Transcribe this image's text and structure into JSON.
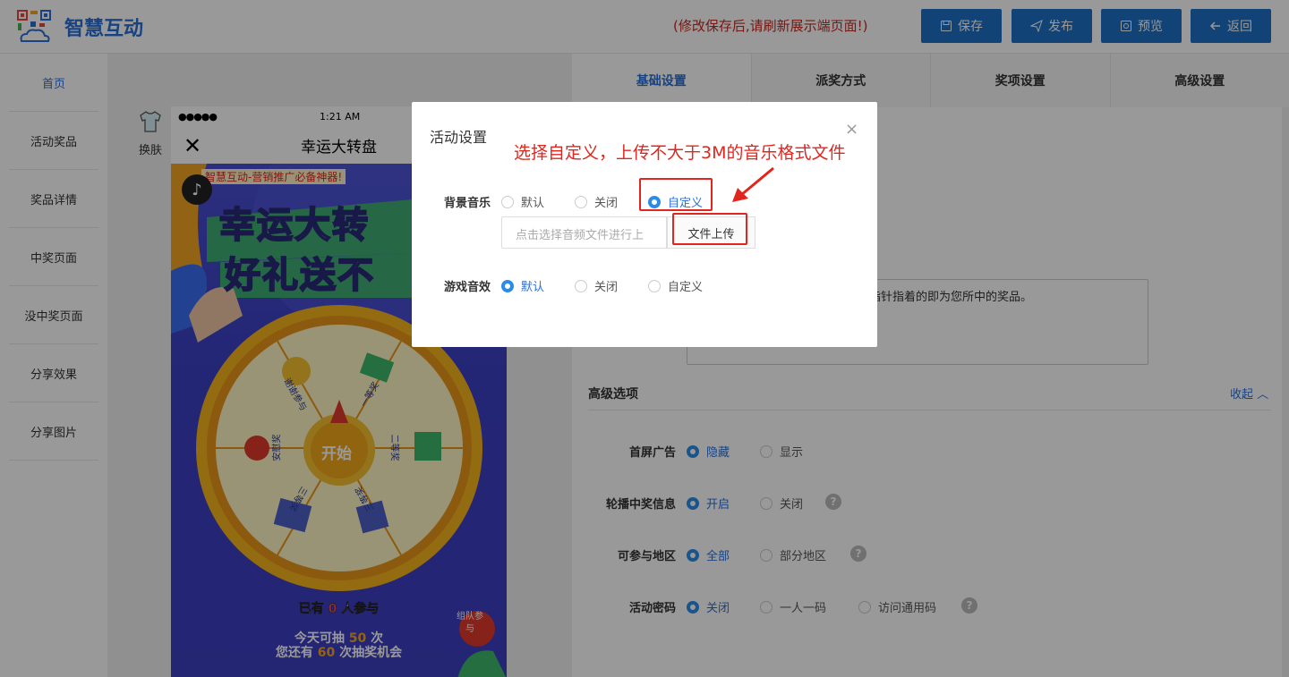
{
  "header": {
    "logo_text": "智慧互动",
    "notice": "(修改保存后,请刷新展示端页面!)",
    "buttons": {
      "save": "保存",
      "publish": "发布",
      "preview": "预览",
      "back": "返回"
    },
    "accent": "#1d70c7"
  },
  "sidebar": {
    "items": [
      {
        "label": "首页"
      },
      {
        "label": "活动奖品"
      },
      {
        "label": "奖品详情"
      },
      {
        "label": "中奖页面"
      },
      {
        "label": "没中奖页面"
      },
      {
        "label": "分享效果"
      },
      {
        "label": "分享图片"
      }
    ]
  },
  "preview": {
    "skin_label": "换肤",
    "status_time": "1:21 AM",
    "signal": "●●●●●",
    "nav_title": "幸运大转盘",
    "banner": "智慧互动-营销推广必备神器!",
    "headline_1": "幸运大转",
    "headline_2": "好礼送不",
    "wheel_center": "开始",
    "wheel_labels": [
      "谢谢参与",
      "一等奖",
      "二等奖",
      "三等奖",
      "三等奖",
      "安慰奖"
    ],
    "participants": {
      "prefix": "已有",
      "count": "0",
      "suffix": "人参与"
    },
    "today": {
      "prefix": "今天可抽",
      "count": "50",
      "suffix": "次"
    },
    "remaining": {
      "prefix": "您还有",
      "count": "60",
      "suffix": "次抽奖机会"
    },
    "team_badge": "组队参与"
  },
  "tabs": [
    {
      "label": "基础设置"
    },
    {
      "label": "派奖方式"
    },
    {
      "label": "奖项设置"
    },
    {
      "label": "高级设置"
    }
  ],
  "settings": {
    "description_text": "终指针指着的即为您所中的奖品。",
    "advanced_title": "高级选项",
    "collapse_label": "收起",
    "rows": [
      {
        "label": "首屏广告",
        "options": [
          "隐藏",
          "显示"
        ],
        "selected": 0
      },
      {
        "label": "轮播中奖信息",
        "options": [
          "开启",
          "关闭"
        ],
        "selected": 0
      },
      {
        "label": "可参与地区",
        "options": [
          "全部",
          "部分地区"
        ],
        "selected": 0
      },
      {
        "label": "活动密码",
        "options": [
          "关闭",
          "一人一码",
          "访问通用码"
        ],
        "selected": 0
      }
    ]
  },
  "modal": {
    "title": "活动设置",
    "close": "×",
    "annotation": "选择自定义，上传不大于3M的音乐格式文件",
    "bg_music": {
      "label": "背景音乐",
      "options": [
        "默认",
        "关闭",
        "自定义"
      ],
      "selected": 2
    },
    "upload_placeholder": "点击选择音频文件进行上",
    "upload_button": "文件上传",
    "game_sound": {
      "label": "游戏音效",
      "options": [
        "默认",
        "关闭",
        "自定义"
      ],
      "selected": 0
    }
  }
}
